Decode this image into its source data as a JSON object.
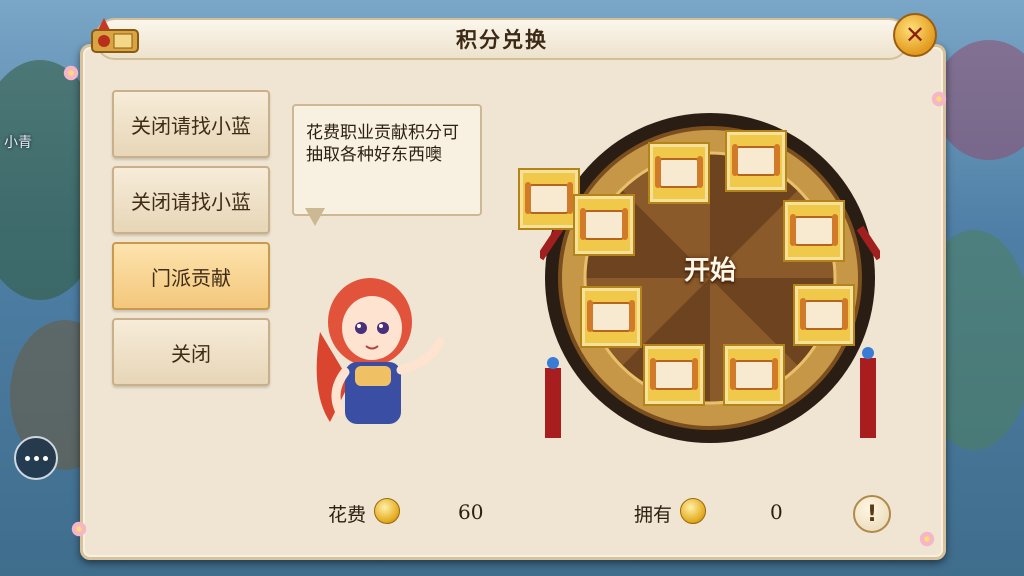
{
  "background": {
    "left_texts": [
      "小青"
    ],
    "chat_icon": "chat-bubble-icon"
  },
  "panel": {
    "title": "积分兑换",
    "close_icon": "close-icon"
  },
  "menu": {
    "items": [
      {
        "label": "关闭请找小蓝"
      },
      {
        "label": "关闭请找小蓝"
      },
      {
        "label": "门派贡献"
      },
      {
        "label": "关闭"
      }
    ]
  },
  "npc": {
    "speech": "花费职业贡献积分可抽取各种好东西噢"
  },
  "wheel": {
    "start_label": "开始",
    "slot_icon": "scroll-icon"
  },
  "cost": {
    "label": "花费",
    "value": "60",
    "coin_icon": "gold-coin-icon"
  },
  "owned": {
    "label": "拥有",
    "value": "0",
    "coin_icon": "gold-coin-icon"
  },
  "info_icon": "exclamation-icon",
  "colors": {
    "panel_bg": "#efe5d2",
    "active_button": "#f3c77c",
    "slot_gold": "#f1c94a",
    "close_button": "#e39b1e"
  }
}
